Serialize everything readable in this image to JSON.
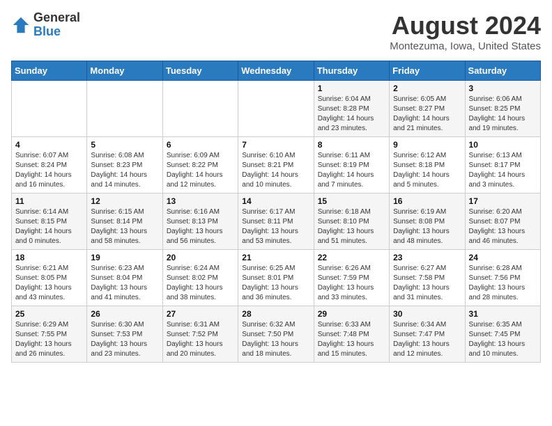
{
  "header": {
    "logo_general": "General",
    "logo_blue": "Blue",
    "month_year": "August 2024",
    "location": "Montezuma, Iowa, United States"
  },
  "weekdays": [
    "Sunday",
    "Monday",
    "Tuesday",
    "Wednesday",
    "Thursday",
    "Friday",
    "Saturday"
  ],
  "weeks": [
    [
      {
        "day": "",
        "info": ""
      },
      {
        "day": "",
        "info": ""
      },
      {
        "day": "",
        "info": ""
      },
      {
        "day": "",
        "info": ""
      },
      {
        "day": "1",
        "info": "Sunrise: 6:04 AM\nSunset: 8:28 PM\nDaylight: 14 hours\nand 23 minutes."
      },
      {
        "day": "2",
        "info": "Sunrise: 6:05 AM\nSunset: 8:27 PM\nDaylight: 14 hours\nand 21 minutes."
      },
      {
        "day": "3",
        "info": "Sunrise: 6:06 AM\nSunset: 8:25 PM\nDaylight: 14 hours\nand 19 minutes."
      }
    ],
    [
      {
        "day": "4",
        "info": "Sunrise: 6:07 AM\nSunset: 8:24 PM\nDaylight: 14 hours\nand 16 minutes."
      },
      {
        "day": "5",
        "info": "Sunrise: 6:08 AM\nSunset: 8:23 PM\nDaylight: 14 hours\nand 14 minutes."
      },
      {
        "day": "6",
        "info": "Sunrise: 6:09 AM\nSunset: 8:22 PM\nDaylight: 14 hours\nand 12 minutes."
      },
      {
        "day": "7",
        "info": "Sunrise: 6:10 AM\nSunset: 8:21 PM\nDaylight: 14 hours\nand 10 minutes."
      },
      {
        "day": "8",
        "info": "Sunrise: 6:11 AM\nSunset: 8:19 PM\nDaylight: 14 hours\nand 7 minutes."
      },
      {
        "day": "9",
        "info": "Sunrise: 6:12 AM\nSunset: 8:18 PM\nDaylight: 14 hours\nand 5 minutes."
      },
      {
        "day": "10",
        "info": "Sunrise: 6:13 AM\nSunset: 8:17 PM\nDaylight: 14 hours\nand 3 minutes."
      }
    ],
    [
      {
        "day": "11",
        "info": "Sunrise: 6:14 AM\nSunset: 8:15 PM\nDaylight: 14 hours\nand 0 minutes."
      },
      {
        "day": "12",
        "info": "Sunrise: 6:15 AM\nSunset: 8:14 PM\nDaylight: 13 hours\nand 58 minutes."
      },
      {
        "day": "13",
        "info": "Sunrise: 6:16 AM\nSunset: 8:13 PM\nDaylight: 13 hours\nand 56 minutes."
      },
      {
        "day": "14",
        "info": "Sunrise: 6:17 AM\nSunset: 8:11 PM\nDaylight: 13 hours\nand 53 minutes."
      },
      {
        "day": "15",
        "info": "Sunrise: 6:18 AM\nSunset: 8:10 PM\nDaylight: 13 hours\nand 51 minutes."
      },
      {
        "day": "16",
        "info": "Sunrise: 6:19 AM\nSunset: 8:08 PM\nDaylight: 13 hours\nand 48 minutes."
      },
      {
        "day": "17",
        "info": "Sunrise: 6:20 AM\nSunset: 8:07 PM\nDaylight: 13 hours\nand 46 minutes."
      }
    ],
    [
      {
        "day": "18",
        "info": "Sunrise: 6:21 AM\nSunset: 8:05 PM\nDaylight: 13 hours\nand 43 minutes."
      },
      {
        "day": "19",
        "info": "Sunrise: 6:23 AM\nSunset: 8:04 PM\nDaylight: 13 hours\nand 41 minutes."
      },
      {
        "day": "20",
        "info": "Sunrise: 6:24 AM\nSunset: 8:02 PM\nDaylight: 13 hours\nand 38 minutes."
      },
      {
        "day": "21",
        "info": "Sunrise: 6:25 AM\nSunset: 8:01 PM\nDaylight: 13 hours\nand 36 minutes."
      },
      {
        "day": "22",
        "info": "Sunrise: 6:26 AM\nSunset: 7:59 PM\nDaylight: 13 hours\nand 33 minutes."
      },
      {
        "day": "23",
        "info": "Sunrise: 6:27 AM\nSunset: 7:58 PM\nDaylight: 13 hours\nand 31 minutes."
      },
      {
        "day": "24",
        "info": "Sunrise: 6:28 AM\nSunset: 7:56 PM\nDaylight: 13 hours\nand 28 minutes."
      }
    ],
    [
      {
        "day": "25",
        "info": "Sunrise: 6:29 AM\nSunset: 7:55 PM\nDaylight: 13 hours\nand 26 minutes."
      },
      {
        "day": "26",
        "info": "Sunrise: 6:30 AM\nSunset: 7:53 PM\nDaylight: 13 hours\nand 23 minutes."
      },
      {
        "day": "27",
        "info": "Sunrise: 6:31 AM\nSunset: 7:52 PM\nDaylight: 13 hours\nand 20 minutes."
      },
      {
        "day": "28",
        "info": "Sunrise: 6:32 AM\nSunset: 7:50 PM\nDaylight: 13 hours\nand 18 minutes."
      },
      {
        "day": "29",
        "info": "Sunrise: 6:33 AM\nSunset: 7:48 PM\nDaylight: 13 hours\nand 15 minutes."
      },
      {
        "day": "30",
        "info": "Sunrise: 6:34 AM\nSunset: 7:47 PM\nDaylight: 13 hours\nand 12 minutes."
      },
      {
        "day": "31",
        "info": "Sunrise: 6:35 AM\nSunset: 7:45 PM\nDaylight: 13 hours\nand 10 minutes."
      }
    ]
  ]
}
